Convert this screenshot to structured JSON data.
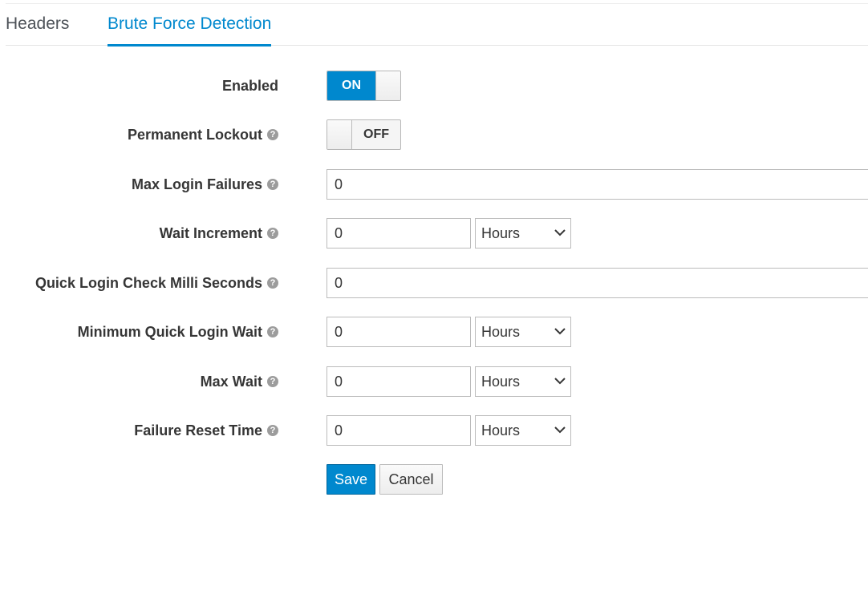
{
  "tabs": [
    {
      "label": "Headers",
      "active": false
    },
    {
      "label": "Brute Force Detection",
      "active": true
    }
  ],
  "form": {
    "enabled": {
      "label": "Enabled",
      "state": "ON"
    },
    "permanent_lockout": {
      "label": "Permanent Lockout",
      "state": "OFF"
    },
    "max_login_failures": {
      "label": "Max Login Failures",
      "value": "0"
    },
    "wait_increment": {
      "label": "Wait Increment",
      "value": "0",
      "unit": "Hours"
    },
    "quick_login_check": {
      "label": "Quick Login Check Milli Seconds",
      "value": "0"
    },
    "min_quick_login_wait": {
      "label": "Minimum Quick Login Wait",
      "value": "0",
      "unit": "Hours"
    },
    "max_wait": {
      "label": "Max Wait",
      "value": "0",
      "unit": "Hours"
    },
    "failure_reset_time": {
      "label": "Failure Reset Time",
      "value": "0",
      "unit": "Hours"
    },
    "help_glyph": "?"
  },
  "actions": {
    "save_label": "Save",
    "cancel_label": "Cancel"
  },
  "icons": {
    "help": "question-circle-icon",
    "dropdown": "chevron-down-icon"
  },
  "colors": {
    "accent": "#0088ce",
    "text": "#363636",
    "border": "#bbbbbb"
  }
}
